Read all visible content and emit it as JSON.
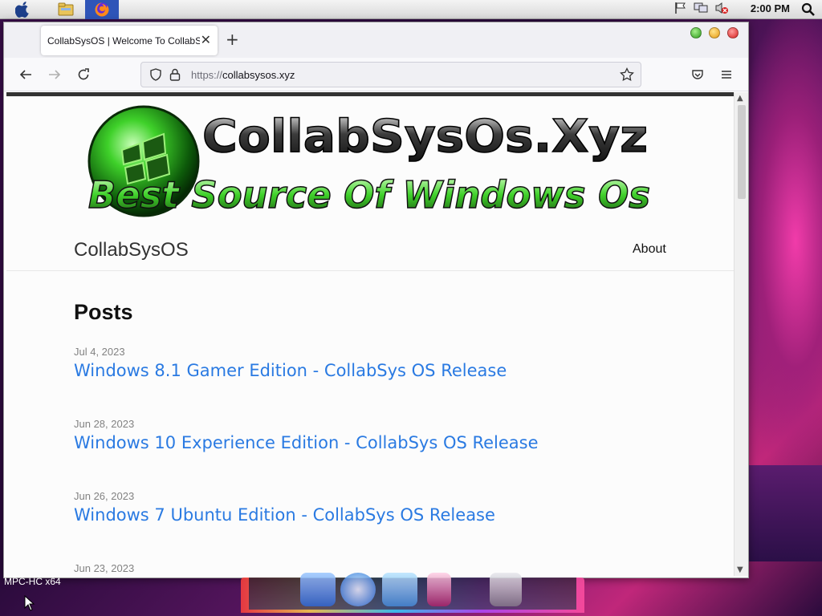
{
  "menubar": {
    "clock": "2:00 PM",
    "apps": [
      "apple-menu",
      "file-manager",
      "firefox"
    ]
  },
  "browser": {
    "tab_title": "CollabSysOS | Welcome To CollabSysOS",
    "new_tab": "+",
    "close_tab": "✕",
    "url_scheme": "https://",
    "url_host": "collabsysos.xyz"
  },
  "page": {
    "banner_title": "CollabSysOs.Xyz",
    "banner_subtitle": "Best Source Of Windows Os",
    "site_title": "CollabSysOS",
    "nav_about": "About",
    "posts_heading": "Posts",
    "posts": [
      {
        "date": "Jul 4, 2023",
        "title": "Windows 8.1 Gamer Edition - CollabSys OS Release"
      },
      {
        "date": "Jun 28, 2023",
        "title": "Windows 10 Experience Edition - CollabSys OS Release"
      },
      {
        "date": "Jun 26, 2023",
        "title": "Windows 7 Ubuntu Edition - CollabSys OS Release"
      },
      {
        "date": "Jun 23, 2023",
        "title": ""
      }
    ]
  },
  "desktop": {
    "taskbar_label": "MPC-HC x64"
  },
  "colors": {
    "link": "#2a7ae2",
    "banner_green": "#3fd12a",
    "firefox_highlight": "#2f55b8"
  }
}
